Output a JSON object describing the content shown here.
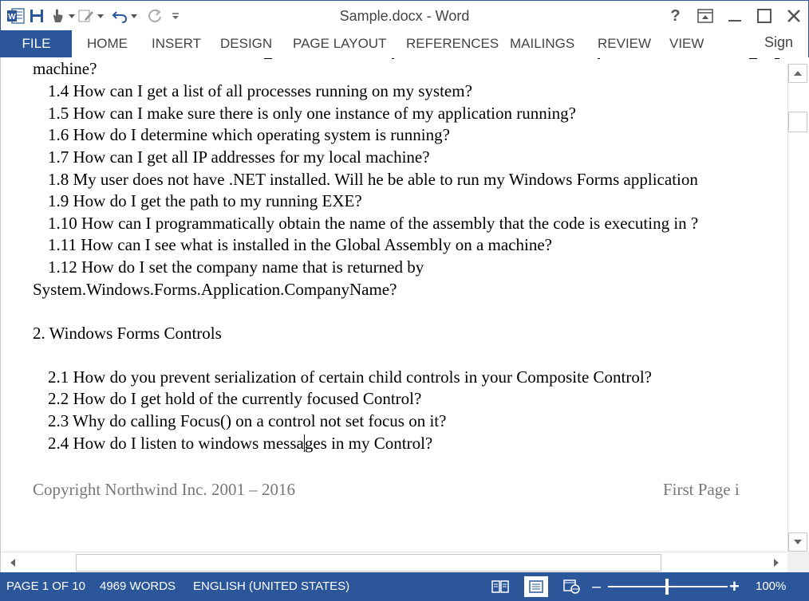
{
  "app": {
    "document_title": "Sample.docx - Word",
    "word_icon_letter": "W",
    "accent_color": "#2b579a"
  },
  "window_controls": {
    "help_label": "?"
  },
  "ribbon": {
    "file_tab": "FILE",
    "tabs": [
      "HOME",
      "INSERT",
      "DESIGN",
      "PAGE LAYOUT",
      "REFERENCES",
      "MAILINGS",
      "REVIEW",
      "VIEW"
    ],
    "sign_in": "Sign in"
  },
  "document": {
    "lines": [
      "machine?",
      "1.4 How can I get a list of all processes running on my system?",
      "1.5 How can I make sure there is only one instance of my application running?",
      "1.6 How do I determine which operating system is running?",
      "1.7 How can I get all IP addresses for my local machine?",
      "1.8 My user does not have .NET installed. Will he be able to run my Windows Forms application",
      "1.9 How do I get the path to my running EXE?",
      "1.10 How can I programmatically obtain the name of the assembly that the code is executing in ?",
      "1.11 How can I see what is installed in the Global Assembly on a machine?",
      "1.12 How do I set the company name that is returned by",
      "System.Windows.Forms.Application.CompanyName?",
      "2. Windows Forms Controls",
      "2.1 How do you prevent serialization of certain child controls in your Composite Control?",
      "2.2 How do I get hold of the currently focused Control?",
      "2.3 Why do calling Focus() on a control not set focus on it?",
      "2.4 How do I listen to windows messa",
      "ges in my Control?"
    ],
    "footer_left": "Copyright Northwind Inc. 2001 – 2016",
    "footer_right": "First Page i"
  },
  "statusbar": {
    "page": "PAGE 1 OF 10",
    "words": "4969 WORDS",
    "language": "ENGLISH (UNITED STATES)",
    "zoom_out": "–",
    "zoom_in": "+",
    "zoom_level": "100%"
  }
}
